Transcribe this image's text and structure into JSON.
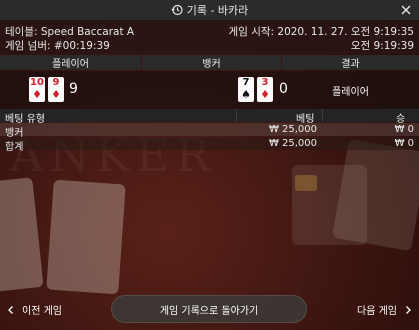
{
  "window": {
    "title": "기록 - 바카라",
    "icons": {
      "history": "history-icon",
      "close": "close-icon"
    }
  },
  "info": {
    "table_label": "테이블: Speed Baccarat A",
    "round_label": "게임 넘버: #00:19:39",
    "start_label": "게임 시작: 2020. 11. 27. 오전 9:19:35",
    "end_time": "오전 9:19:39"
  },
  "headers": {
    "player": "플레이어",
    "banker": "뱅커",
    "result": "결과"
  },
  "player": {
    "cards": [
      {
        "rank": "10",
        "suit": "♦",
        "color": "#d1202b"
      },
      {
        "rank": "9",
        "suit": "♦",
        "color": "#d1202b"
      }
    ],
    "score": "9"
  },
  "banker": {
    "cards": [
      {
        "rank": "7",
        "suit": "♠",
        "color": "#111111"
      },
      {
        "rank": "3",
        "suit": "♦",
        "color": "#d1202b"
      }
    ],
    "score": "0"
  },
  "result": "플레이어",
  "bets": {
    "headers": {
      "type": "베팅 유형",
      "bet": "베팅",
      "win": "승"
    },
    "rows": [
      {
        "type": "뱅커",
        "bet": "₩ 25,000",
        "win": "₩ 0"
      },
      {
        "type": "합계",
        "bet": "₩ 25,000",
        "win": "₩ 0"
      }
    ]
  },
  "footer": {
    "prev": "이전 게임",
    "back": "게임 기록으로 돌아가기",
    "next": "다음 게임"
  },
  "background": {
    "felt_text": "ANKER"
  }
}
